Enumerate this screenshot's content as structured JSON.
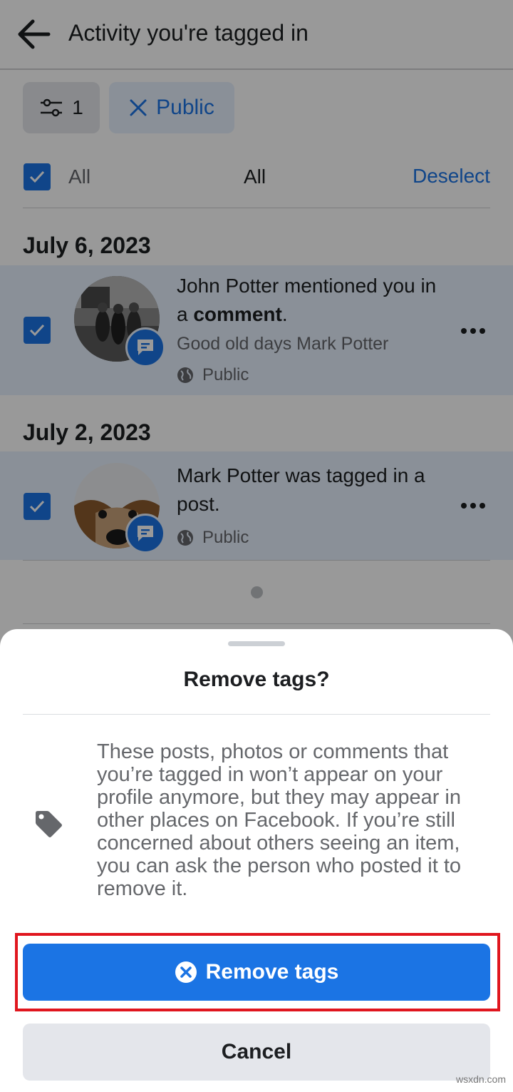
{
  "header": {
    "title": "Activity you're tagged in"
  },
  "filters": {
    "count": "1",
    "public_chip": "Public"
  },
  "select_all": {
    "label": "All",
    "center_label": "All",
    "deselect": "Deselect"
  },
  "groups": [
    {
      "date": "July 6, 2023",
      "item": {
        "text_prefix": "John Potter mentioned you in a ",
        "text_bold": "comment",
        "text_suffix": ".",
        "subtitle": "Good old days Mark Potter",
        "privacy": "Public",
        "checked": true
      }
    },
    {
      "date": "July 2, 2023",
      "item": {
        "text": "Mark Potter was tagged in a post.",
        "privacy": "Public",
        "checked": true
      }
    }
  ],
  "sheet": {
    "title": "Remove tags?",
    "body": "These posts, photos or comments that you’re tagged in won’t appear on your profile anymore, but they may appear in other places on Facebook. If you’re still concerned about others seeing an item, you can ask the person who posted it to remove it.",
    "remove_button": "Remove tags",
    "cancel_button": "Cancel"
  },
  "watermark": "wsxdn.com",
  "colors": {
    "accent": "#1b74e4",
    "highlight": "#e0161e"
  },
  "icons": [
    "back-arrow-icon",
    "filter-sliders-icon",
    "close-icon",
    "checkbox-checked-icon",
    "comment-badge-icon",
    "globe-icon",
    "more-horizontal-icon",
    "tag-icon",
    "remove-circle-icon"
  ]
}
